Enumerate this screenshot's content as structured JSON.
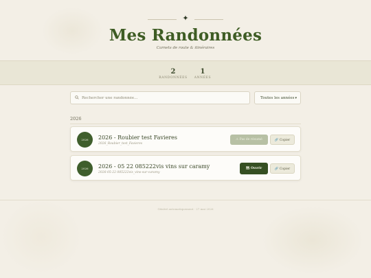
{
  "header": {
    "ornament_icon": "✦",
    "title": "Mes Randonnées",
    "subtitle": "Carnets de route & itinéraires"
  },
  "stats": [
    {
      "value": "2",
      "label": "RANDONNÉES"
    },
    {
      "value": "1",
      "label": "ANNÉES"
    }
  ],
  "search": {
    "icon": "search-icon",
    "placeholder": "Rechercher une randonnée…",
    "value": ""
  },
  "year_filter": {
    "selected": "Toutes les années"
  },
  "groups": [
    {
      "year": "2026",
      "items": [
        {
          "badge": "2026",
          "title": "2026 - Roubier test Favieres",
          "subtitle": "2026_Roubier_test_Favieres",
          "primary_label": "⚠ Pas de résumé",
          "primary_enabled": false,
          "copy_label": "🔗 Copier"
        },
        {
          "badge": "2026",
          "title": "2026 - 05 22 085222vis vins sur caramy",
          "subtitle": "2026-05-22 085222vis_vins-sur-caramy",
          "primary_label": "🗺 Ouvrir",
          "primary_enabled": true,
          "copy_label": "🔗 Copier"
        }
      ]
    }
  ],
  "footer": {
    "text": "Généré automatiquement · 27 mai 2026"
  },
  "colors": {
    "accent": "#3f5e2c",
    "background": "#f3efe6",
    "band": "#e9e6d6"
  }
}
